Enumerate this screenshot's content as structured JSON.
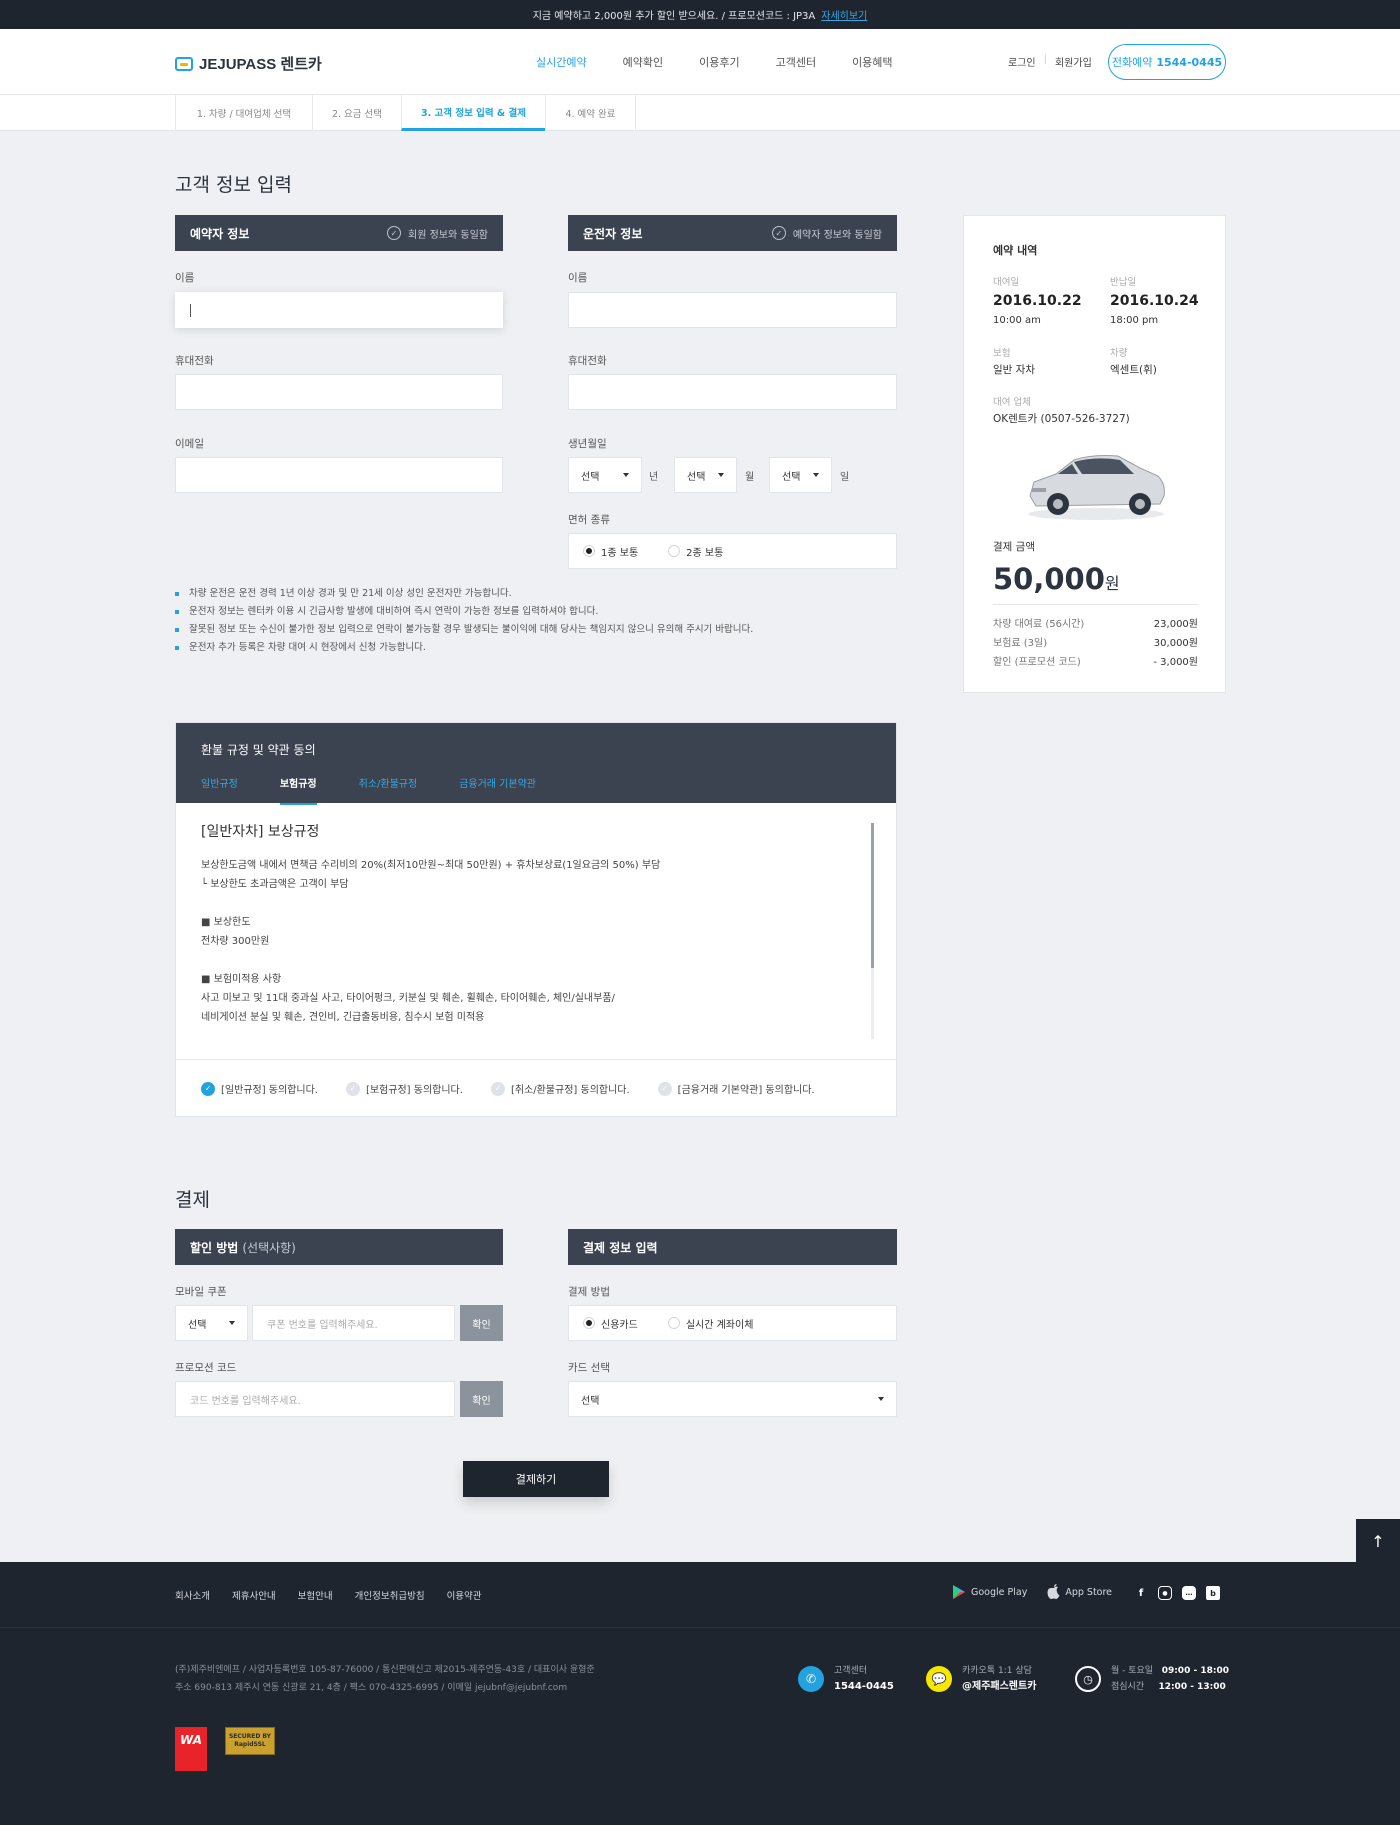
{
  "topbar": {
    "promo": "지금 예약하고 2,000원 추가 할인 받으세요. / 프로모션코드 : JP3A",
    "more": "자세히보기"
  },
  "header": {
    "logo": "JEJUPASS 렌트카",
    "nav": [
      "실시간예약",
      "예약확인",
      "이용후기",
      "고객센터",
      "이용혜택"
    ],
    "login": "로그인",
    "join": "회원가입",
    "tel_label": "전화예약",
    "tel_number": "1544-0445"
  },
  "steps": [
    "1. 차량 / 대여업체 선택",
    "2. 요금 선택",
    "3. 고객 정보 입력 & 결제",
    "4. 예약 완료"
  ],
  "customer": {
    "title": "고객 정보 입력",
    "booker": {
      "header": "예약자 정보",
      "check": "회원 정보와 동일함",
      "name_label": "이름",
      "phone_label": "휴대전화",
      "email_label": "이메일"
    },
    "driver": {
      "header": "운전자 정보",
      "check": "예약자 정보와 동일함",
      "name_label": "이름",
      "phone_label": "휴대전화",
      "birth_label": "생년월일",
      "select": "선택",
      "year": "년",
      "month": "월",
      "day": "일",
      "license_label": "면허 종류",
      "license_opts": [
        "1종 보통",
        "2종 보통"
      ]
    },
    "notes": [
      "차량 운전은 운전 경력 1년 이상 경과 및 만 21세 이상 성인 운전자만 가능합니다.",
      "운전자 정보는 렌터카 이용 시 긴급사항 발생에 대비하여 즉시 연락이 가능한 정보를 입력하셔야 합니다.",
      "잘못된 정보 또는 수신이 불가한 정보 입력으로 연락이 불가능할 경우 발생되는 불이익에 대해 당사는 책임지지 않으니 유의해 주시기 바랍니다.",
      "운전자 추가 등록은 차량 대여 시 현장에서 신청 가능합니다."
    ]
  },
  "summary": {
    "title": "예약 내역",
    "pickup_label": "대여일",
    "pickup_date": "2016.10.22",
    "pickup_time": "10:00 am",
    "return_label": "반납일",
    "return_date": "2016.10.24",
    "return_time": "18:00 pm",
    "ins_label": "보험",
    "ins_value": "일반 자차",
    "car_label": "차량",
    "car_value": "엑센트(휘)",
    "company_label": "대여 업체",
    "company_value": "OK렌트카 (0507-526-3727)",
    "pay_label": "결제 금액",
    "total": "50,000",
    "won": "원",
    "rows": [
      {
        "k": "차량 대여료 (56시간)",
        "v": "23,000원"
      },
      {
        "k": "보험료 (3일)",
        "v": "30,000원"
      },
      {
        "k": "할인 (프로모션 코드)",
        "v": "- 3,000원"
      }
    ]
  },
  "terms": {
    "title": "환불 규정 및 약관 동의",
    "tabs": [
      "일반규정",
      "보험규정",
      "취소/환불규정",
      "금융거래 기본약관"
    ],
    "heading": "[일반자차] 보상규정",
    "lines": [
      "보상한도금액 내에서 면책금 수리비의 20%(최저10만원~최대 50만원) + 휴차보상료(1일요금의 50%) 부담",
      "└ 보상한도 초과금액은 고객이 부담",
      "",
      "■ 보상한도",
      "전차량 300만원",
      "",
      "■ 보험미적용 사항",
      "사고 미보고 및 11대 중과실 사고, 타이어펑크, 키분실 및 훼손, 휠훼손, 타이어훼손, 체인/실내부품/",
      "네비게이션 분실 및 훼손, 견인비, 긴급출동비용, 침수시 보험 미적용"
    ],
    "agrees": [
      "[일반규정] 동의합니다.",
      "[보험규정] 동의합니다.",
      "[취소/환불규정] 동의합니다.",
      "[금융거래 기본약관] 동의합니다."
    ]
  },
  "payment": {
    "title": "결제",
    "discount_header": "할인 방법",
    "discount_optional": "(선택사항)",
    "coupon_label": "모바일 쿠폰",
    "select": "선택",
    "coupon_ph": "쿠폰 번호를 입력해주세요.",
    "confirm": "확인",
    "promo_label": "프로모션 코드",
    "promo_ph": "코드 번호를 입력해주세요.",
    "info_header": "결제 정보 입력",
    "method_label": "결제 방법",
    "methods": [
      "신용카드",
      "실시간 계좌이체"
    ],
    "card_label": "카드 선택",
    "card_select": "선택",
    "submit": "결제하기"
  },
  "footer": {
    "links": [
      "회사소개",
      "제휴사안내",
      "보험안내",
      "개인정보취급방침",
      "이용약관"
    ],
    "google": "Google Play",
    "apple": "App Store",
    "info1": "(주)제주비엔에프  /  사업자등록번호 105-87-76000  /  통신판매신고 제2015-제주연동-43호  /  대표이사 윤형준",
    "info2": "주소 690-813 제주시 연동 신광로 21, 4층  /  팩스 070-4325-6995  /  이메일 jejubnf@jejubnf.com",
    "cs_label": "고객센터",
    "cs_number": "1544-0445",
    "kakao_label": "카카오톡 1:1 상담",
    "kakao_id": "@제주패스렌트카",
    "hours1_label": "월 - 토요일",
    "hours1": "09:00 - 18:00",
    "hours2_label": "점심시간",
    "hours2": "12:00 - 13:00",
    "wa": "WA",
    "ssl": "SECURED BY RapidSSL"
  },
  "colors": {
    "accent": "#23a2e0",
    "dark": "#1f252f",
    "panel": "#3c4350"
  }
}
